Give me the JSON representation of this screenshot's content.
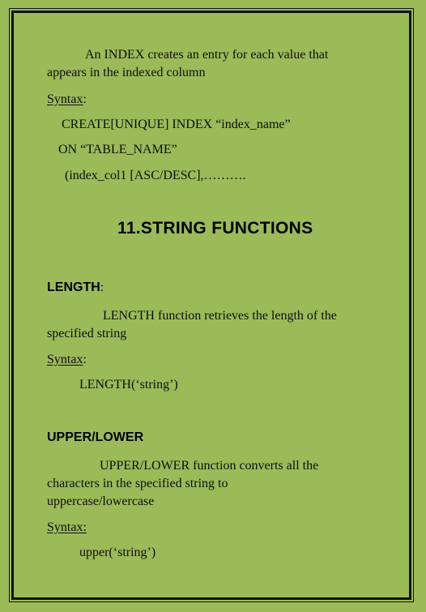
{
  "index_section": {
    "intro_line1": "An INDEX creates an entry for each value that",
    "intro_line2": "appears in the indexed column",
    "syntax_label": "Syntax",
    "syntax_colon": ":",
    "syntax_line1": "CREATE[UNIQUE] INDEX   “index_name”",
    "syntax_line2": "ON  “TABLE_NAME”",
    "syntax_line3": "(index_col1 [ASC/DESC],………."
  },
  "section_title": "11.STRING FUNCTIONS",
  "length_section": {
    "heading": "LENGTH",
    "heading_colon": ":",
    "desc_line1": "LENGTH function retrieves the length of the",
    "desc_line2": "specified string",
    "syntax_label": "Syntax",
    "syntax_colon": ":",
    "syntax_line1": "LENGTH(‘string’)"
  },
  "upper_lower_section": {
    "heading": "UPPER/LOWER",
    "desc_line1": "UPPER/LOWER  function converts all the",
    "desc_line2": "characters  in the specified string to",
    "desc_line3": "uppercase/lowercase",
    "syntax_label": "Syntax:",
    "syntax_line1": "upper(‘string’)"
  }
}
